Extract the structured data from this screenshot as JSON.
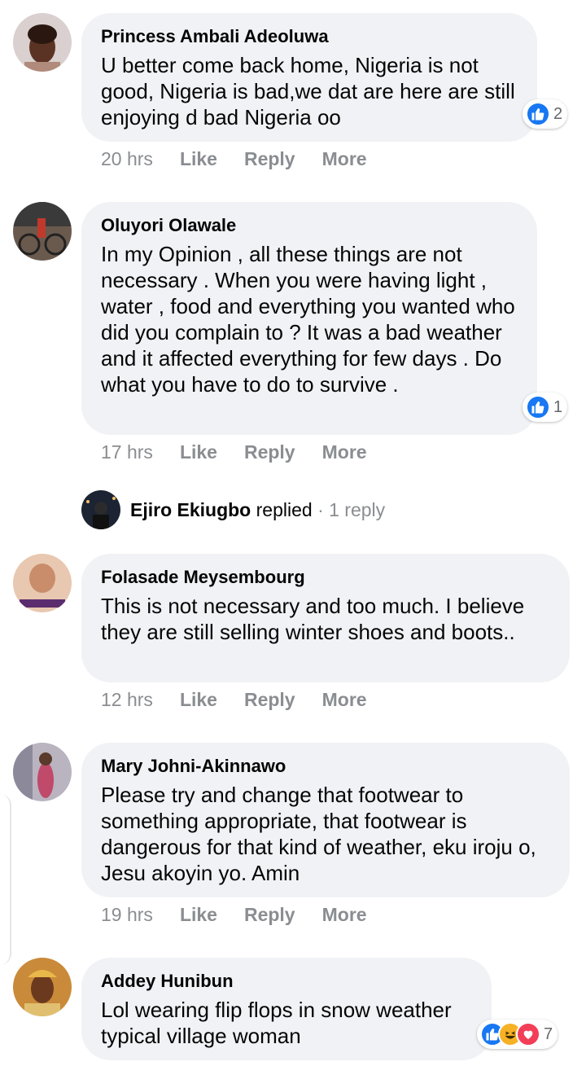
{
  "comments": [
    {
      "author": "Princess Ambali Adeoluwa",
      "text": "U better come back home, Nigeria is not good, Nigeria is bad,we dat are here are still enjoying d bad Nigeria oo",
      "time": "20 hrs",
      "like": "Like",
      "reply": "Reply",
      "more": "More",
      "reaction_count": "2"
    },
    {
      "author": "Oluyori Olawale",
      "text": "In my Opinion , all these things are not necessary . When you were having light , water , food and everything you wanted who did you complain to ? It was a bad weather and it affected everything for few days . Do what you have to do to survive .",
      "time": "17 hrs",
      "like": "Like",
      "reply": "Reply",
      "more": "More",
      "reaction_count": "1"
    },
    {
      "author": "Folasade Meysembourg",
      "text": "This is not necessary and too much. I believe they are still selling winter shoes and boots..",
      "time": "12 hrs",
      "like": "Like",
      "reply": "Reply",
      "more": "More"
    },
    {
      "author": "Mary Johni-Akinnawo",
      "text": "Please try and change that footwear to something appropriate, that footwear is dangerous for that kind of weather, eku iroju o, Jesu akoyin yo. Amin",
      "time": "19 hrs",
      "like": "Like",
      "reply": "Reply",
      "more": "More"
    },
    {
      "author": "Addey Hunibun",
      "text": "Lol wearing flip flops in snow weather typical village woman",
      "reaction_count": "7"
    }
  ],
  "reply_preview": {
    "author": "Ejiro Ekiugbo",
    "action": "replied",
    "separator": "·",
    "count": "1 reply"
  },
  "colors": {
    "bubble": "#f0f2f5",
    "meta": "#8a8d91",
    "like_blue": "#1877f2",
    "love_red": "#f33e58",
    "haha_yellow": "#f7b125"
  },
  "icons": [
    "like-reaction-icon",
    "haha-reaction-icon",
    "love-reaction-icon",
    "avatar"
  ]
}
